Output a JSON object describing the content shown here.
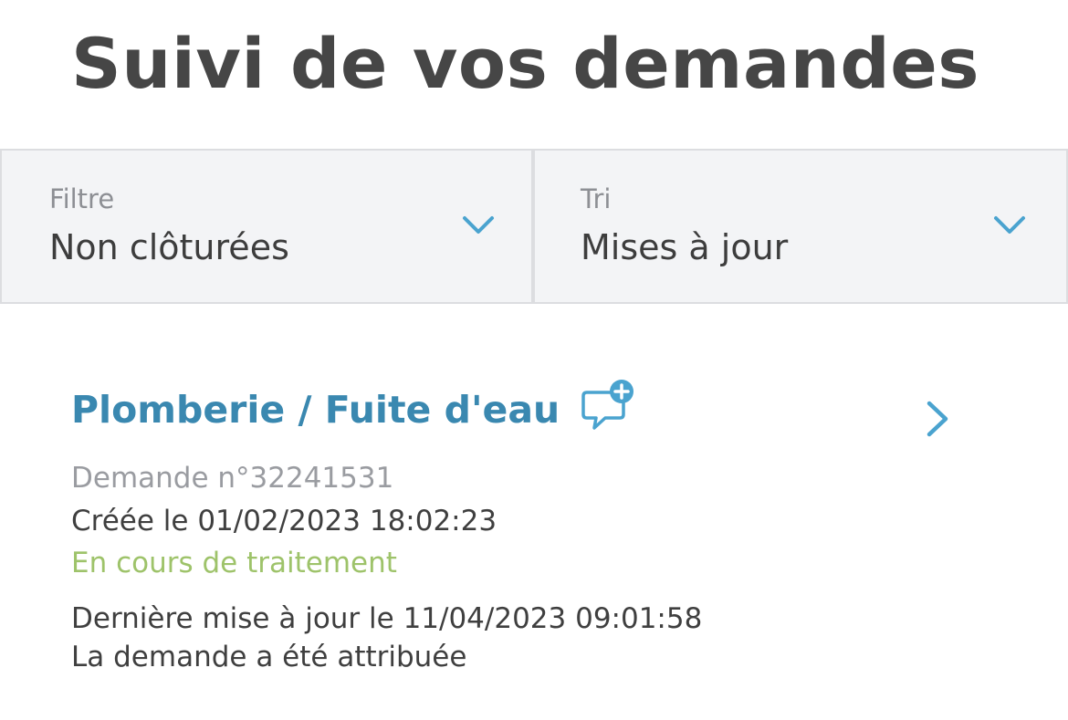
{
  "page": {
    "title": "Suivi de vos demandes"
  },
  "filters": {
    "filter": {
      "label": "Filtre",
      "value": "Non clôturées",
      "icon": "chevron-down-icon"
    },
    "sort": {
      "label": "Tri",
      "value": "Mises à jour",
      "icon": "chevron-down-icon"
    }
  },
  "requests": [
    {
      "title": "Plomberie / Fuite d'eau",
      "title_icon": "chat-plus-icon",
      "number": "Demande n°32241531",
      "created": "Créée le 01/02/2023 18:02:23",
      "status": "En cours de traitement",
      "last_update": "Dernière mise à jour le 11/04/2023 09:01:58",
      "last_event": "La demande a été attribuée",
      "open_icon": "chevron-right-icon"
    }
  ],
  "colors": {
    "title_text": "#464646",
    "accent": "#3a88b0",
    "chevron": "#4aa3cf",
    "status_in_progress": "#9ec36a",
    "muted_text": "#9a9ca1",
    "filter_background": "#f3f4f6",
    "filter_border": "#dcdde0"
  }
}
